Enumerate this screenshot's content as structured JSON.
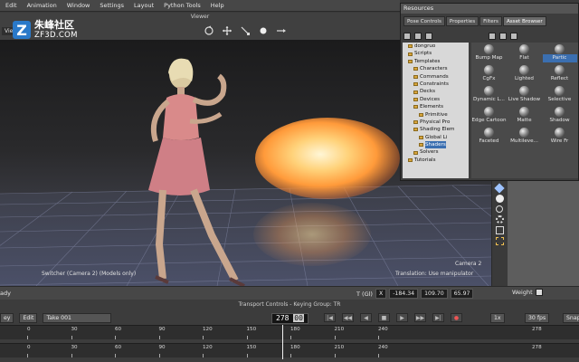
{
  "menubar": {
    "items": [
      "Edit",
      "Animation",
      "Window",
      "Settings",
      "Layout",
      "Python Tools",
      "Help"
    ]
  },
  "viewer": {
    "title": "Viewer",
    "label": "View",
    "switcher_text": "Switcher (Camera 2) (Models only)",
    "translation_text": "Translation: Use manipulator",
    "camera_label": "Camera 2"
  },
  "watermark": {
    "cn": "朱峰社区",
    "en": "ZF3D.COM"
  },
  "resources": {
    "title": "Resources",
    "tabs": [
      "Pose Controls",
      "Properties",
      "Filters",
      "Asset Browser"
    ],
    "active_tab": "Asset Browser",
    "tree": [
      {
        "label": "dongruo",
        "level": 1
      },
      {
        "label": "Scripts",
        "level": 1
      },
      {
        "label": "Templates",
        "level": 1
      },
      {
        "label": "Characters",
        "level": 2
      },
      {
        "label": "Commands",
        "level": 2
      },
      {
        "label": "Constraints",
        "level": 2
      },
      {
        "label": "Decks",
        "level": 2
      },
      {
        "label": "Devices",
        "level": 2
      },
      {
        "label": "Elements",
        "level": 2
      },
      {
        "label": "Primitive",
        "level": 3
      },
      {
        "label": "Physical Pro",
        "level": 2
      },
      {
        "label": "Shading Elem",
        "level": 2
      },
      {
        "label": "Global Li",
        "level": 3
      },
      {
        "label": "Shaders",
        "level": 3
      },
      {
        "label": "Solvers",
        "level": 2
      },
      {
        "label": "Tutorials",
        "level": 1
      }
    ],
    "selected_tree": "Shaders",
    "assets": [
      "Bump Map",
      "Flat",
      "Partic",
      "CgFx",
      "Lighted",
      "Reflect",
      "Dynamic L...",
      "Live Shadow",
      "Selective",
      "Edge Cartoon",
      "Matte",
      "Shadow",
      "Faceted",
      "Multileve...",
      "Wire Fr"
    ],
    "selected_asset": "Partic"
  },
  "status": {
    "ready": "ady",
    "transform_mode": "T (Gl)",
    "transform_axis": "X",
    "x": "-184.34",
    "y": "109.70",
    "z": "65.97",
    "weight_label": "Weight"
  },
  "transport": {
    "title": "Transport Controls  -  Keying Group: TR",
    "mode": "ey",
    "edit": "Edit",
    "take": "Take 001",
    "time": "278",
    "time_frac": "00",
    "speed": "1x",
    "fps": "30 fps",
    "snap": "Snap",
    "ruler1": [
      "0",
      "30",
      "60",
      "90",
      "120",
      "150",
      "180",
      "210",
      "240"
    ],
    "ruler1_end": "278",
    "ruler2": [
      "0",
      "30",
      "60",
      "90",
      "120",
      "150",
      "180",
      "210",
      "240"
    ],
    "ruler2_end": "278"
  },
  "colors": {
    "accent": "#3b6fb0",
    "particle": "#ffb04a",
    "character_outfit": "#d98a8a"
  }
}
